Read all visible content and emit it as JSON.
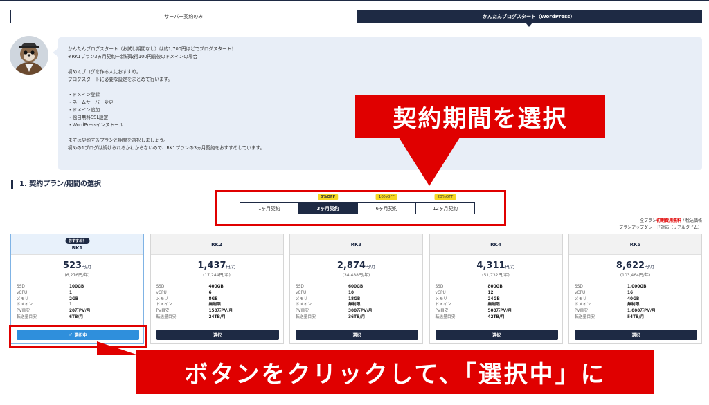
{
  "mode_tabs": [
    {
      "label": "サーバー契約のみ",
      "active": false
    },
    {
      "label": "かんたんブログスタート（WordPress）",
      "active": true
    }
  ],
  "info": {
    "line1": "かんたんブログスタート（お試し期間なし）は約1,700円ほどでブログスタート！",
    "line2": "※RK1プラン3ヵ月契約＋新規取得100円前後のドメインの場合",
    "line3": "初めてブログを作る人におすすめ。",
    "line4": "ブログスタートに必要な設定をまとめて行います。",
    "items": [
      "・ドメイン登録",
      "・ネームサーバー変更",
      "・ドメイン追加",
      "・独自無料SSL設定",
      "・WordPressインストール"
    ],
    "line5": "まずは契約するプランと期間を選択しましょう。",
    "line6": "初めの1ブログは続けられるかわからないので、RK1プランの3ヵ月契約をおすすめしています。"
  },
  "annotations": {
    "top": "契約期間を選択",
    "bottom": "ボタンをクリックして、「選択中」に"
  },
  "section_title": "1. 契約プラン/期間の選択",
  "period_tabs": [
    {
      "label": "1ヶ月契約",
      "badge": "",
      "active": false
    },
    {
      "label": "3ヶ月契約",
      "badge": "5%OFF",
      "active": true
    },
    {
      "label": "6ヶ月契約",
      "badge": "10%OFF",
      "active": false
    },
    {
      "label": "12ヶ月契約",
      "badge": "20%OFF",
      "active": false
    }
  ],
  "notes": {
    "prefix": "全プラン",
    "highlight": "初期費用無料",
    "suffix": " / 税込価格",
    "line2": "プランアップグレード対応（リアルタイム）"
  },
  "spec_labels": [
    "SSD",
    "vCPU",
    "メモリ",
    "ドメイン",
    "PV目安",
    "転送量目安"
  ],
  "plans": [
    {
      "name": "RK1",
      "badge": "おすすめ！",
      "price": "523",
      "unit": "円/月",
      "yearly": "(6,276円/年)",
      "specs": [
        "100GB",
        "1",
        "2GB",
        "1",
        "20万PV/月",
        "6TB/月"
      ],
      "button": "選択中",
      "selected": true
    },
    {
      "name": "RK2",
      "badge": "",
      "price": "1,437",
      "unit": "円/月",
      "yearly": "(17,244円/年)",
      "specs": [
        "400GB",
        "6",
        "8GB",
        "無制限",
        "150万PV/月",
        "24TB/月"
      ],
      "button": "選択",
      "selected": false
    },
    {
      "name": "RK3",
      "badge": "",
      "price": "2,874",
      "unit": "円/月",
      "yearly": "(34,488円/年)",
      "specs": [
        "600GB",
        "10",
        "18GB",
        "無制限",
        "300万PV/月",
        "36TB/月"
      ],
      "button": "選択",
      "selected": false
    },
    {
      "name": "RK4",
      "badge": "",
      "price": "4,311",
      "unit": "円/月",
      "yearly": "(51,732円/年)",
      "specs": [
        "800GB",
        "12",
        "24GB",
        "無制限",
        "500万PV/月",
        "42TB/月"
      ],
      "button": "選択",
      "selected": false
    },
    {
      "name": "RK5",
      "badge": "",
      "price": "8,622",
      "unit": "円/月",
      "yearly": "(103,464円/年)",
      "specs": [
        "1,000GB",
        "16",
        "40GB",
        "無制限",
        "1,000万PV/月",
        "54TB/月"
      ],
      "button": "選択",
      "selected": false
    }
  ],
  "colors": {
    "navy": "#1e2a44",
    "accent_red": "#e00000",
    "selected_blue": "#2f8fdc",
    "badge_yellow": "#f5d623"
  }
}
